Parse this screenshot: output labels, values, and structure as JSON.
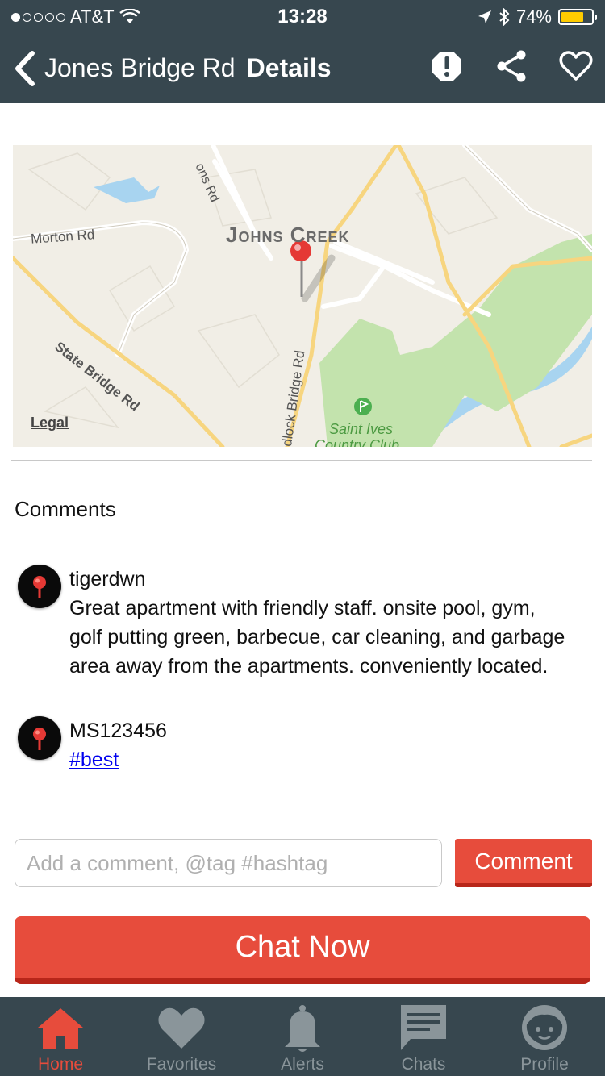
{
  "status_bar": {
    "carrier": "AT&T",
    "time": "13:28",
    "battery": "74%",
    "battery_level": 0.74
  },
  "nav": {
    "title": "Jones Bridge Rd",
    "subtitle": "Details",
    "icons": [
      "back-chevron-icon",
      "alert-icon",
      "share-icon",
      "heart-icon"
    ]
  },
  "map": {
    "labels": {
      "johns_creek": "Johns Creek",
      "morton_rd": "Morton Rd",
      "state_bridge_rd": "State Bridge Rd",
      "ons_rd": "ons Rd",
      "bridge_rd": "dlock Bridge Rd",
      "saint_ives": "Saint Ives",
      "country_club": "Country Club"
    },
    "legal": "Legal",
    "pin_color": "#e53935"
  },
  "comments": {
    "title": "Comments",
    "items": [
      {
        "user": "tigerdwn",
        "text": "Great apartment with friendly staff. onsite pool, gym, golf putting green, barbecue, car cleaning, and garbage area away from the apartments. conveniently located."
      },
      {
        "user": "MS123456",
        "hashtag": "#best"
      }
    ]
  },
  "composer": {
    "placeholder": "Add a comment, @tag #hashtag",
    "comment_button": "Comment",
    "chat_button": "Chat Now"
  },
  "tabs": [
    {
      "label": "Home",
      "icon": "home-icon",
      "active": true
    },
    {
      "label": "Favorites",
      "icon": "heart-icon",
      "active": false
    },
    {
      "label": "Alerts",
      "icon": "bell-icon",
      "active": false
    },
    {
      "label": "Chats",
      "icon": "chat-icon",
      "active": false
    },
    {
      "label": "Profile",
      "icon": "face-icon",
      "active": false
    }
  ],
  "colors": {
    "bar": "#37474f",
    "accent": "#e74c3c",
    "tab_inactive": "#8a959a"
  }
}
